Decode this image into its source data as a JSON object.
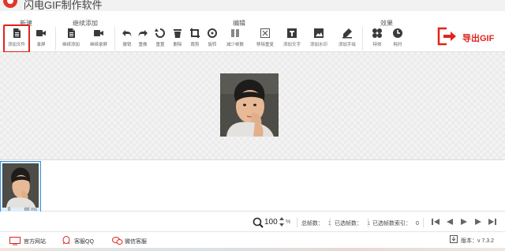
{
  "app": {
    "title": "闪电GIF制作软件"
  },
  "toolbar": {
    "groups": {
      "new": "新建",
      "continue_add": "继续添加",
      "edit": "编辑",
      "effects": "效果"
    },
    "tools": {
      "add_file": "添加文件",
      "record": "录屏",
      "continue_add": "继续添加",
      "continue_record": "继续录屏",
      "undo": "撤销",
      "redo": "重做",
      "reset": "重置",
      "delete": "删除",
      "crop": "裁剪",
      "rotate": "旋转",
      "reduce_frames": "减少帧数",
      "remove_duplicates": "移除重复",
      "add_text": "添加文字",
      "add_watermark": "添加水印",
      "add_drawing": "添加手绘",
      "effects": "特效",
      "timing": "耗时"
    },
    "export_label": "导出GIF",
    "accent_color": "#e0241b"
  },
  "filmstrip": {
    "frames": [
      {
        "index": "0",
        "duration": "66 ms"
      }
    ],
    "selection_color": "#3b8fd8"
  },
  "statusbar": {
    "zoom_value": "100",
    "zoom_unit": "%",
    "total_frames_label": "总帧数：",
    "total_frames": "1",
    "selected_frames_label": "已选帧数：",
    "selected_frames": "1",
    "selected_index_label": "已选帧数索引：",
    "selected_index": "0"
  },
  "footer": {
    "website": "官方网站",
    "qq_support": "客服QQ",
    "wechat_support": "微信客服",
    "version": "版本：v 7.3.2"
  }
}
